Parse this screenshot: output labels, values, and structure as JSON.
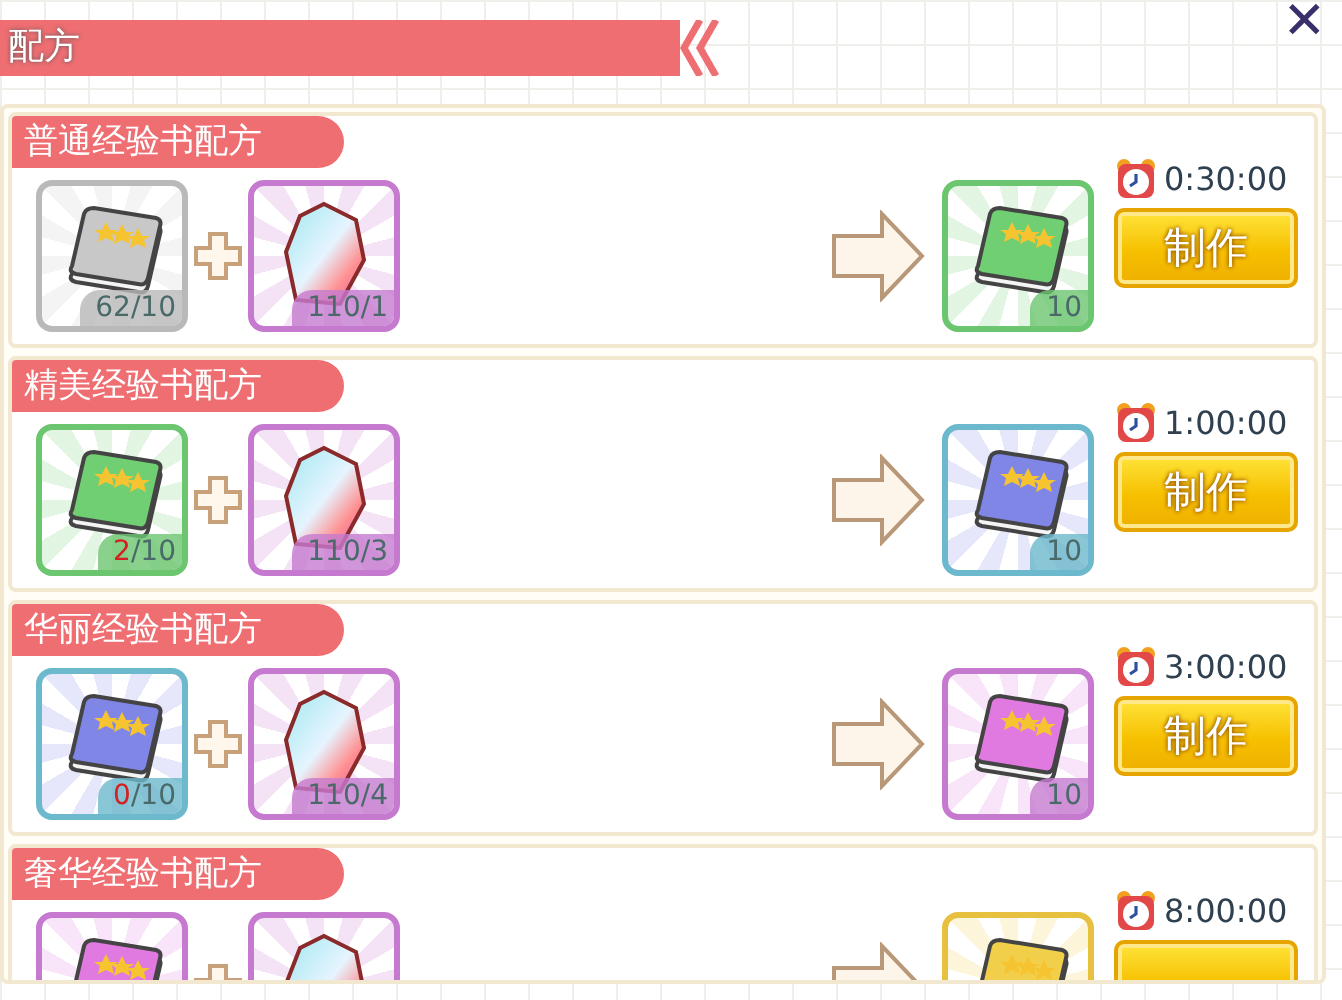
{
  "header": {
    "title": "配方",
    "close": "✕"
  },
  "recipes": [
    {
      "title": "普通经验书配方",
      "inputs": [
        {
          "kind": "book",
          "color": "#c8c8c8",
          "have": "62",
          "need": "/10",
          "short": false
        },
        {
          "kind": "gem",
          "color": "#c86fd0",
          "have": "110",
          "need": "/1",
          "short": false
        }
      ],
      "output": {
        "kind": "book",
        "color": "#6fcf72",
        "count": "10"
      },
      "time": "0:30:00",
      "button": "制作"
    },
    {
      "title": "精美经验书配方",
      "inputs": [
        {
          "kind": "book",
          "color": "#6fcf72",
          "have": "2",
          "need": "/10",
          "short": true
        },
        {
          "kind": "gem",
          "color": "#c86fd0",
          "have": "110",
          "need": "/3",
          "short": false
        }
      ],
      "output": {
        "kind": "book",
        "color": "#7f86e6",
        "count": "10"
      },
      "time": "1:00:00",
      "button": "制作"
    },
    {
      "title": "华丽经验书配方",
      "inputs": [
        {
          "kind": "book",
          "color": "#7f86e6",
          "have": "0",
          "need": "/10",
          "short": true
        },
        {
          "kind": "gem",
          "color": "#c86fd0",
          "have": "110",
          "need": "/4",
          "short": false
        }
      ],
      "output": {
        "kind": "book",
        "color": "#e07ae0",
        "count": "10"
      },
      "time": "3:00:00",
      "button": "制作"
    },
    {
      "title": "奢华经验书配方",
      "inputs": [
        {
          "kind": "book",
          "color": "#e07ae0"
        },
        {
          "kind": "gem",
          "color": "#c86fd0"
        }
      ],
      "output": {
        "kind": "book",
        "color": "#f2cf4a"
      },
      "time": "8:00:00"
    }
  ]
}
